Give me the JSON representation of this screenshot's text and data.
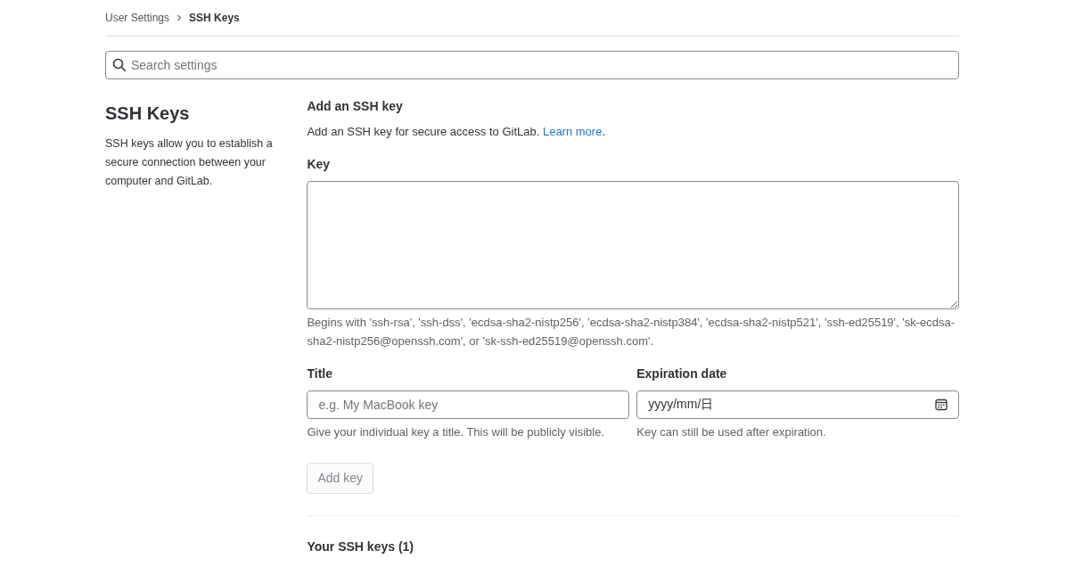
{
  "breadcrumb": [
    {
      "label": "User Settings",
      "current": false
    },
    {
      "label": "SSH Keys",
      "current": true
    }
  ],
  "search": {
    "placeholder": "Search settings"
  },
  "section": {
    "title": "SSH Keys",
    "description": "SSH keys allow you to establish a secure connection between your computer and GitLab."
  },
  "form": {
    "heading": "Add an SSH key",
    "intro": "Add an SSH key for secure access to GitLab.",
    "learn_more": "Learn more",
    "intro_end": ".",
    "key": {
      "label": "Key",
      "help": "Begins with 'ssh-rsa', 'ssh-dss', 'ecdsa-sha2-nistp256', 'ecdsa-sha2-nistp384', 'ecdsa-sha2-nistp521', 'ssh-ed25519', 'sk-ecdsa-sha2-nistp256@openssh.com', or 'sk-ssh-ed25519@openssh.com'."
    },
    "title": {
      "label": "Title",
      "placeholder": "e.g. My MacBook key",
      "help": "Give your individual key a title. This will be publicly visible."
    },
    "expiration": {
      "label": "Expiration date",
      "value": "yyyy/mm/日",
      "help": "Key can still be used after expiration."
    },
    "submit": {
      "label": "Add key",
      "disabled": true
    }
  },
  "keys_heading": "Your SSH keys (1)"
}
